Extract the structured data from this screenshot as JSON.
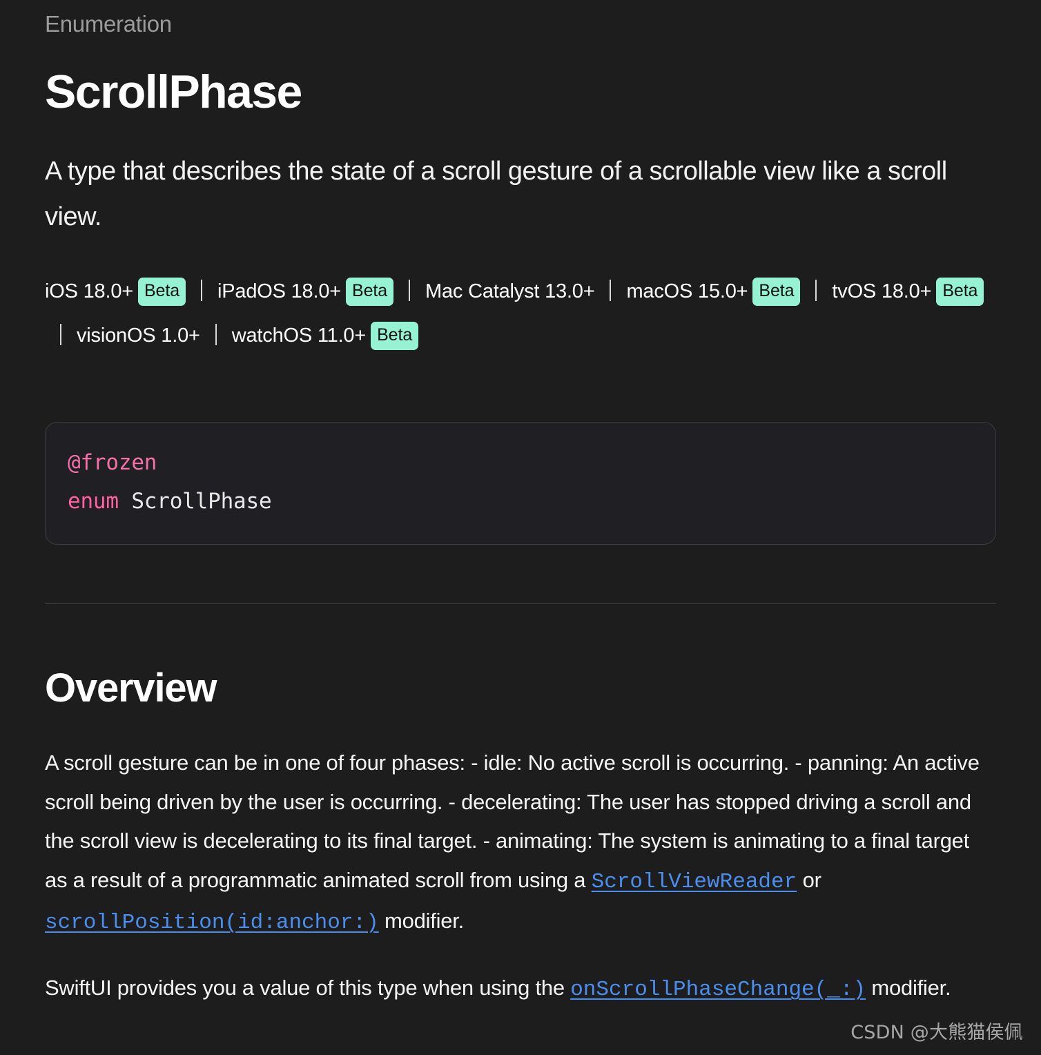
{
  "page": {
    "background_color": "#1d1d1d",
    "eyebrow": "Enumeration",
    "title": "ScrollPhase",
    "abstract": "A type that describes the state of a scroll gesture of a scrollable view like a scroll view."
  },
  "availability": {
    "beta_label": "Beta",
    "badge_color": "#95f3d4",
    "platforms": [
      {
        "name": "iOS 18.0+",
        "beta": true
      },
      {
        "name": "iPadOS 18.0+",
        "beta": true
      },
      {
        "name": "Mac Catalyst 13.0+",
        "beta": false
      },
      {
        "name": "macOS 15.0+",
        "beta": true
      },
      {
        "name": "tvOS 18.0+",
        "beta": true
      },
      {
        "name": "visionOS 1.0+",
        "beta": false
      },
      {
        "name": "watchOS 11.0+",
        "beta": true
      }
    ]
  },
  "declaration": {
    "attribute": "@frozen",
    "keyword": "enum",
    "type_name": "ScrollPhase",
    "line1": "@frozen",
    "line2_keyword": "enum",
    "line2_name": " ScrollPhase",
    "accent_color": "#ff5fa2",
    "background_color": "#202024"
  },
  "overview": {
    "heading": "Overview",
    "paragraph1": {
      "part1": "A scroll gesture can be in one of four phases: - idle: No active scroll is occurring. - panning: An active scroll being driven by the user is occurring. - decelerating: The user has stopped driving a scroll and the scroll view is decelerating to its final target. - animating: The system is animating to a final target as a result of a programmatic animated scroll from using a ",
      "link1": "ScrollViewReader",
      "part2": " or ",
      "link2": "scrollPosition(id:anchor:)",
      "part3": " modifier."
    },
    "paragraph2": {
      "part1": "SwiftUI provides you a value of this type when using the ",
      "link1": "onScrollPhaseChange(_:)",
      "part2": " modifier."
    },
    "link_color": "#4a8ff0"
  },
  "watermark": {
    "text": "CSDN @大熊猫侯佩"
  }
}
